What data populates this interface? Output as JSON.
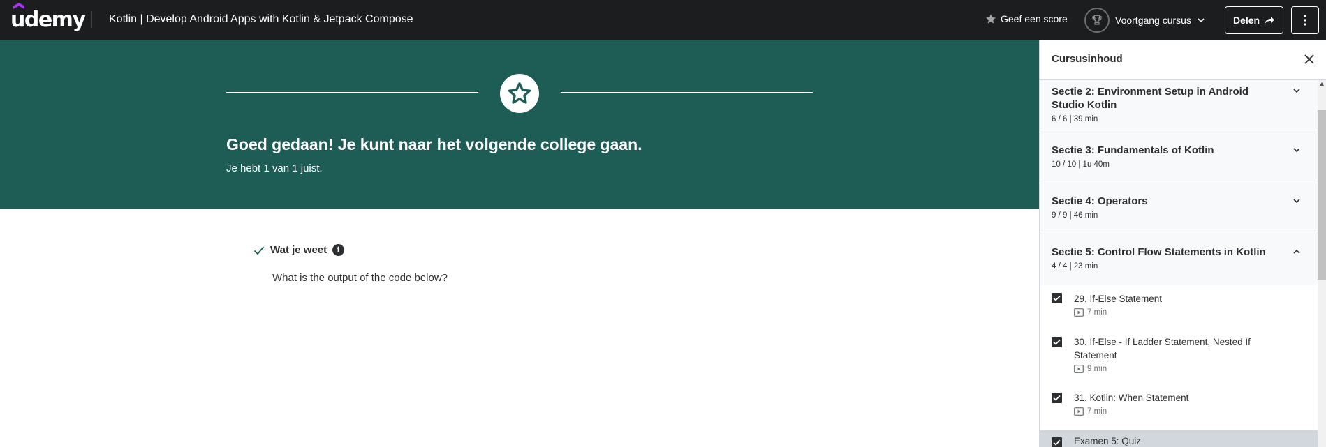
{
  "header": {
    "logo": "udemy",
    "course_title": "Kotlin | Develop Android Apps with Kotlin & Jetpack Compose",
    "rate_label": "Geef een score",
    "progress_label": "Voortgang cursus",
    "share_label": "Delen"
  },
  "banner": {
    "title": "Goed gedaan! Je kunt naar het volgende college gaan.",
    "subtitle": "Je hebt 1 van 1 juist."
  },
  "quiz": {
    "known_label": "Wat je weet",
    "info": "i",
    "question": "What is the output of the code below?"
  },
  "sidebar": {
    "title": "Cursusinhoud",
    "sections": [
      {
        "title": "Sectie 2: Environment Setup in Android Studio Kotlin",
        "meta": "6 / 6 | 39 min",
        "expanded": false
      },
      {
        "title": "Sectie 3: Fundamentals of Kotlin",
        "meta": "10 / 10 | 1u 40m",
        "expanded": false
      },
      {
        "title": "Sectie 4: Operators",
        "meta": "9 / 9 | 46 min",
        "expanded": false
      },
      {
        "title": "Sectie 5: Control Flow Statements in Kotlin",
        "meta": "4 / 4 | 23 min",
        "expanded": true
      }
    ],
    "lectures": [
      {
        "title": "29. If-Else Statement",
        "duration": "7 min",
        "done": true
      },
      {
        "title": "30. If-Else - If Ladder Statement, Nested If Statement",
        "duration": "9 min",
        "done": true
      },
      {
        "title": "31. Kotlin: When Statement",
        "duration": "7 min",
        "done": true
      },
      {
        "title": "Examen 5: Quiz",
        "duration": "",
        "done": true,
        "active": true
      }
    ]
  },
  "colors": {
    "topbar": "#1c1d1f",
    "banner": "#1e5d55",
    "accent": "#a435f0",
    "check_green": "#1e6055"
  }
}
